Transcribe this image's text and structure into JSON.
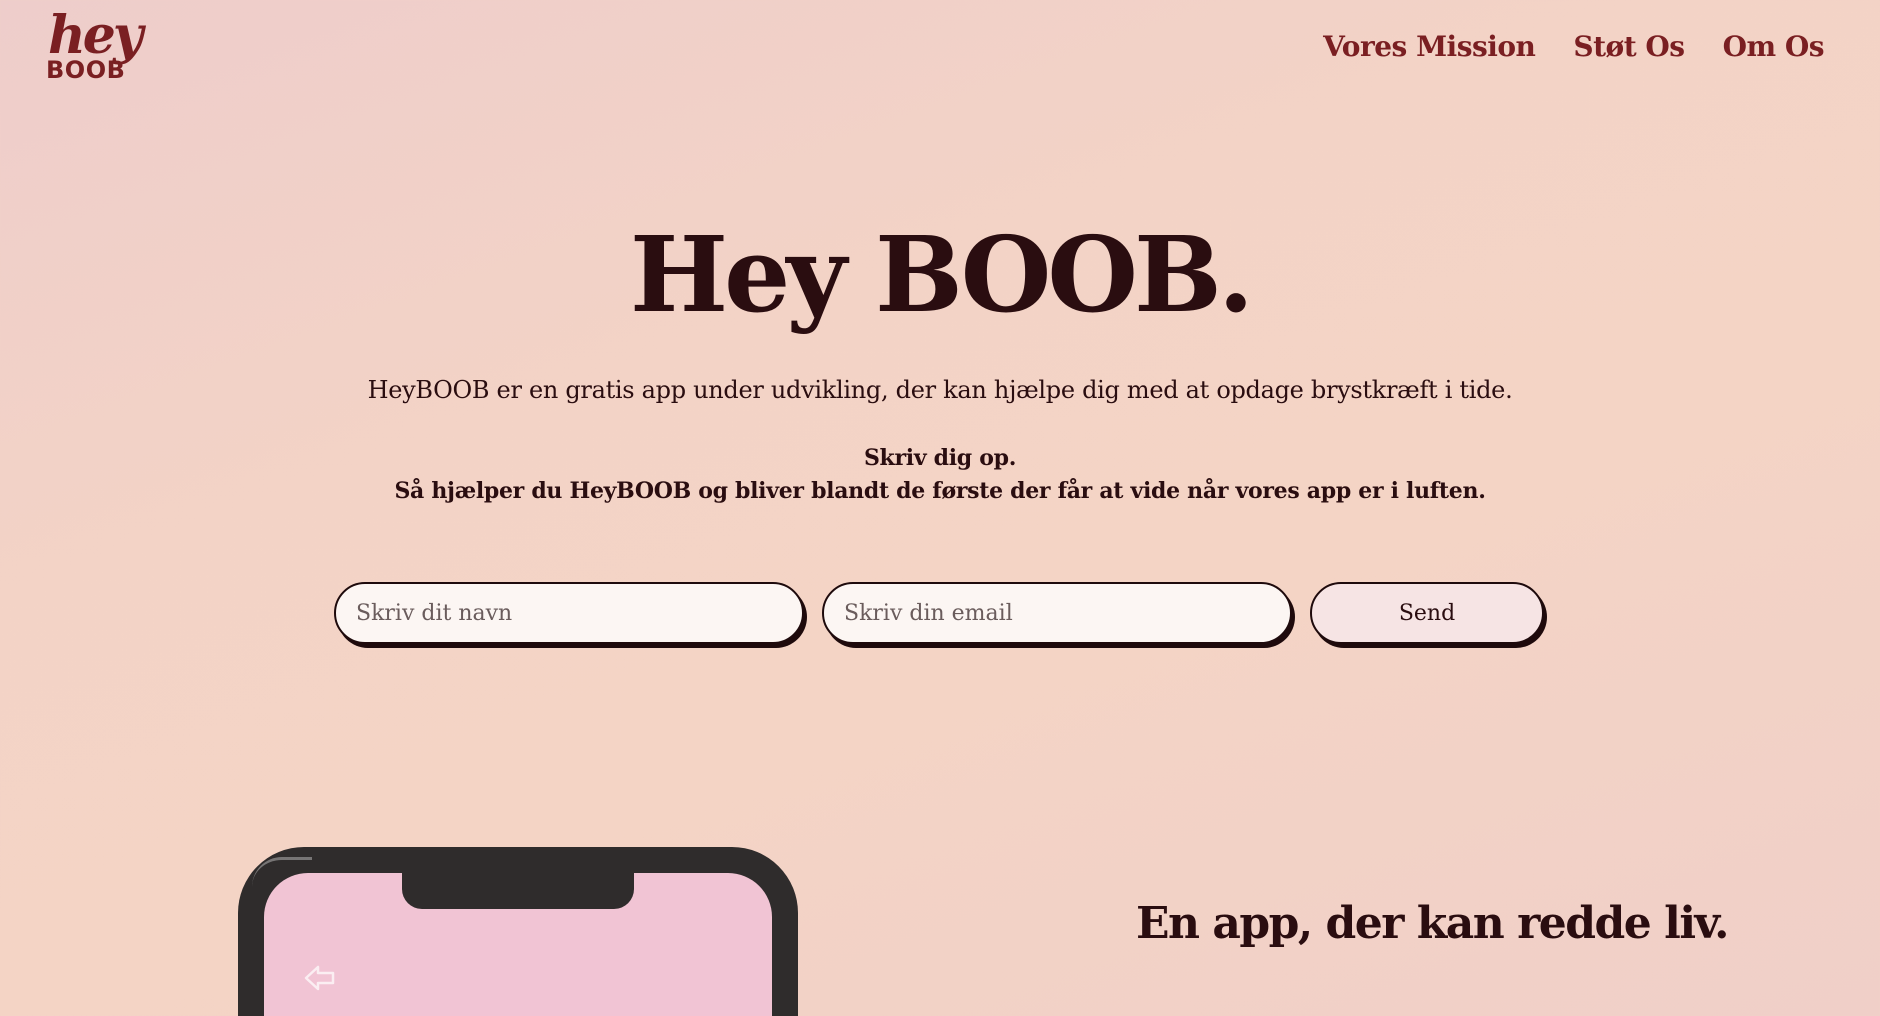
{
  "logo": {
    "top": "hey",
    "bottom": "BOOB"
  },
  "nav": {
    "items": [
      {
        "label": "Vores Mission"
      },
      {
        "label": "Støt Os"
      },
      {
        "label": "Om Os"
      }
    ]
  },
  "hero": {
    "title": "Hey BOOB.",
    "subtitle": "HeyBOOB er en gratis app under udvikling, der kan hjælpe dig med at opdage brystkræft i tide.",
    "cta_line1": "Skriv dig op.",
    "cta_line2": "Så hjælper du HeyBOOB og bliver blandt de første der får at vide når vores app er i luften."
  },
  "form": {
    "name_placeholder": "Skriv dit navn",
    "name_value": "",
    "email_placeholder": "Skriv din email",
    "email_value": "",
    "send_label": "Send"
  },
  "feature": {
    "tagline": "En app, der kan redde liv.",
    "back_icon": "back-arrow-icon"
  },
  "colors": {
    "brand": "#7a1f22",
    "text": "#2a0d10",
    "phone_frame": "#2f2c2c",
    "phone_screen": "#f1c4d4"
  }
}
